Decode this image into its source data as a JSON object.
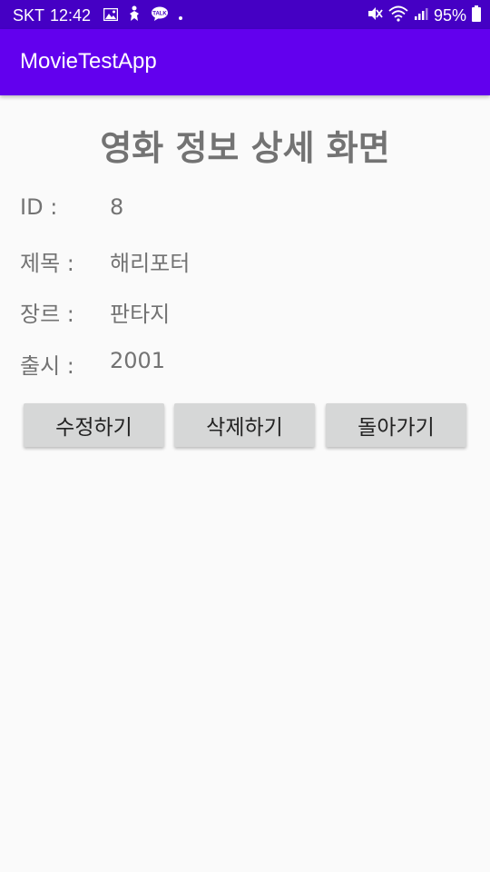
{
  "status_bar": {
    "carrier": "SKT",
    "time": "12:42",
    "battery_percent": "95%",
    "background": "#4500c4"
  },
  "app_bar": {
    "title": "MovieTestApp",
    "background": "#6200ee"
  },
  "page": {
    "title": "영화 정보 상세 화면"
  },
  "details": [
    {
      "label": "ID :",
      "value": "8"
    },
    {
      "label": "제목 :",
      "value": "해리포터"
    },
    {
      "label": "장르 :",
      "value": "판타지"
    },
    {
      "label": "출시 :",
      "value": "2001"
    }
  ],
  "buttons": {
    "edit": "수정하기",
    "delete": "삭제하기",
    "back": "돌아가기"
  }
}
